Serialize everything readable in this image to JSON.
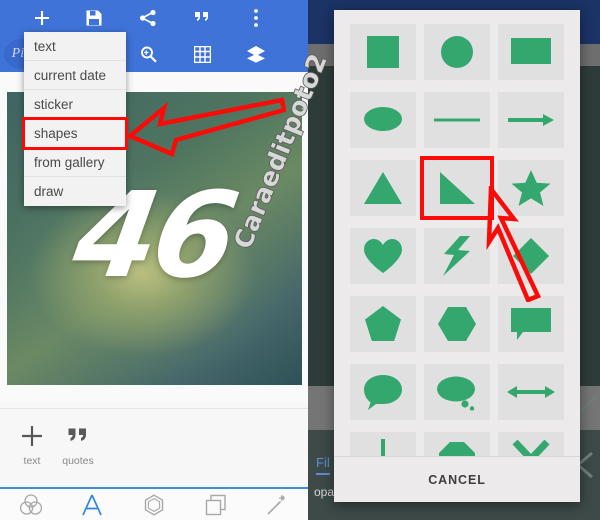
{
  "app": {
    "brand_mark": "Pix",
    "toolbar": {
      "row1": [
        {
          "name": "add-icon",
          "glyph": "+"
        },
        {
          "name": "save-icon",
          "glyph": "save"
        },
        {
          "name": "share-icon",
          "glyph": "share"
        },
        {
          "name": "quotes-icon",
          "glyph": "”"
        },
        {
          "name": "overflow-menu-icon",
          "glyph": "⋮"
        }
      ],
      "row2": [
        {
          "name": "zoom-icon",
          "glyph": "zoom"
        },
        {
          "name": "grid-icon",
          "glyph": "grid"
        },
        {
          "name": "layers-icon",
          "glyph": "layers"
        }
      ]
    },
    "canvas": {
      "photo_number_text": "46",
      "photo_alt": "green gradient background with number 46"
    },
    "tool_strip": [
      {
        "label": "text",
        "icon": "plus-icon"
      },
      {
        "label": "quotes",
        "icon": "quote-icon"
      }
    ],
    "bottom_nav": [
      {
        "name": "filters-tab",
        "icon": "overlapping-circles-icon",
        "active": false
      },
      {
        "name": "text-tab",
        "icon": "letter-a-icon",
        "active": true
      },
      {
        "name": "shapes-tab",
        "icon": "hexagon-icon",
        "active": false
      },
      {
        "name": "layers-tab",
        "icon": "stacked-squares-icon",
        "active": false
      },
      {
        "name": "effects-tab",
        "icon": "magic-wand-icon",
        "active": false
      }
    ]
  },
  "add_menu": {
    "items": [
      {
        "label": "text",
        "highlighted": false
      },
      {
        "label": "current date",
        "highlighted": false
      },
      {
        "label": "sticker",
        "highlighted": false
      },
      {
        "label": "shapes",
        "highlighted": true
      },
      {
        "label": "from gallery",
        "highlighted": false
      },
      {
        "label": "draw",
        "highlighted": false
      }
    ]
  },
  "right_panel": {
    "filters_label": "Fil",
    "opacity_label": "opa"
  },
  "shapes_dialog": {
    "cancel_label": "CANCEL",
    "shapes": [
      {
        "name": "square-shape",
        "selected": false
      },
      {
        "name": "circle-shape",
        "selected": false
      },
      {
        "name": "rectangle-shape",
        "selected": false
      },
      {
        "name": "ellipse-shape",
        "selected": false
      },
      {
        "name": "line-shape",
        "selected": false
      },
      {
        "name": "arrow-right-shape",
        "selected": false
      },
      {
        "name": "triangle-shape",
        "selected": false
      },
      {
        "name": "right-triangle-shape",
        "selected": true
      },
      {
        "name": "star-shape",
        "selected": false
      },
      {
        "name": "heart-shape",
        "selected": false
      },
      {
        "name": "lightning-bolt-shape",
        "selected": false
      },
      {
        "name": "diamond-shape",
        "selected": false
      },
      {
        "name": "pentagon-shape",
        "selected": false
      },
      {
        "name": "hexagon-shape",
        "selected": false
      },
      {
        "name": "speech-box-shape",
        "selected": false
      },
      {
        "name": "speech-bubble-shape",
        "selected": false
      },
      {
        "name": "thought-bubble-shape",
        "selected": false
      },
      {
        "name": "double-arrow-shape",
        "selected": false
      },
      {
        "name": "arrow-down-shape",
        "selected": false
      },
      {
        "name": "octagon-shape",
        "selected": false
      },
      {
        "name": "cross-shape",
        "selected": false
      }
    ]
  },
  "annotations": {
    "watermark_text": "Caraeditpoto2",
    "arrow_color": "#fb0b08",
    "highlight_color": "#fb0b08",
    "shape_fill_color": "#34a76f",
    "toolbar_color": "#3f73d8"
  }
}
